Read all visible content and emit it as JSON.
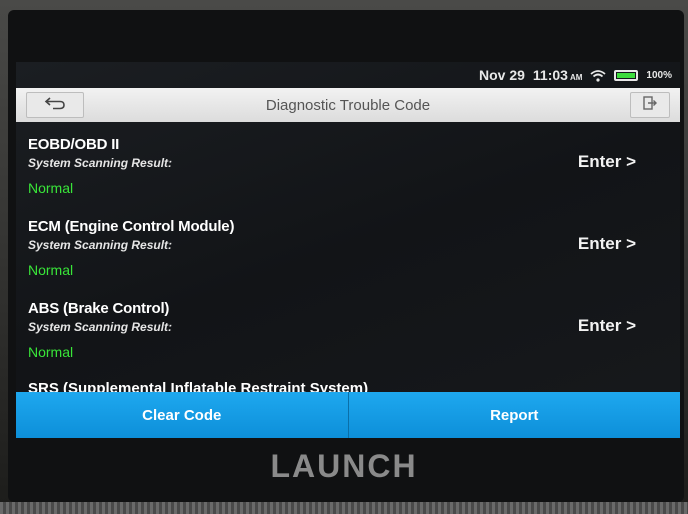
{
  "status": {
    "date": "Nov 29",
    "time": "11:03",
    "ampm": "AM",
    "battery": "100%",
    "icons": [
      "wifi-icon",
      "battery-icon"
    ]
  },
  "header": {
    "title": "Diagnostic Trouble Code",
    "back_icon": "back-arrow-icon",
    "exit_icon": "exit-icon"
  },
  "systems": [
    {
      "name": "EOBD/OBD II",
      "subtitle": "System Scanning Result:",
      "status": "Normal",
      "action": "Enter >"
    },
    {
      "name": "ECM (Engine Control Module)",
      "subtitle": "System Scanning Result:",
      "status": "Normal",
      "action": "Enter >"
    },
    {
      "name": "ABS (Brake Control)",
      "subtitle": "System Scanning Result:",
      "status": "Normal",
      "action": "Enter >"
    }
  ],
  "partial_item": "SRS (Supplemental Inflatable Restraint System)",
  "footer": {
    "clear_label": "Clear Code",
    "report_label": "Report"
  },
  "brand": "LAUNCH",
  "colors": {
    "accent": "#1ea8ef",
    "normal": "#39e639",
    "battery": "#3ddc3d"
  }
}
